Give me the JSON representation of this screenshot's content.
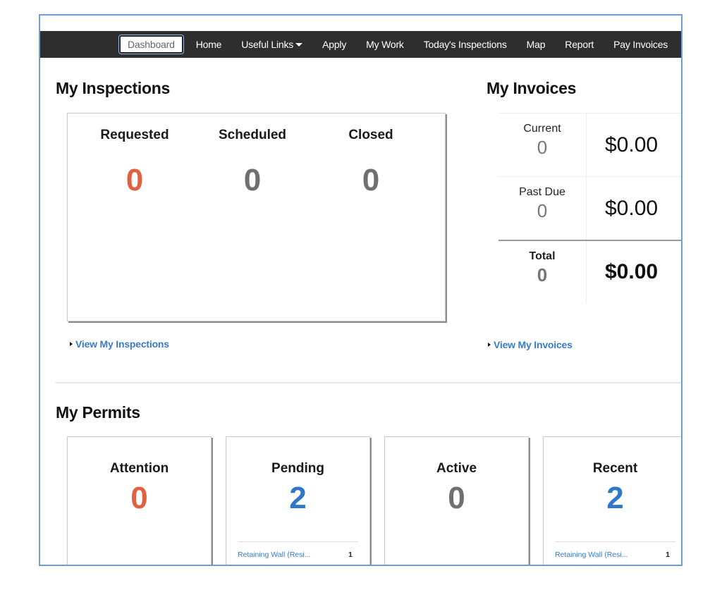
{
  "nav": {
    "items": [
      {
        "label": "Dashboard",
        "active": true
      },
      {
        "label": "Home"
      },
      {
        "label": "Useful Links",
        "has_dropdown": true
      },
      {
        "label": "Apply"
      },
      {
        "label": "My Work"
      },
      {
        "label": "Today's Inspections"
      },
      {
        "label": "Map"
      },
      {
        "label": "Report"
      },
      {
        "label": "Pay Invoices"
      }
    ]
  },
  "inspections": {
    "title": "My Inspections",
    "columns": [
      {
        "label": "Requested",
        "value": "0",
        "color": "#e0603f"
      },
      {
        "label": "Scheduled",
        "value": "0",
        "color": "#6f6f6f"
      },
      {
        "label": "Closed",
        "value": "0",
        "color": "#6f6f6f"
      }
    ],
    "link": "View My Inspections"
  },
  "invoices": {
    "title": "My Invoices",
    "rows": [
      {
        "label": "Current",
        "count": "0",
        "amount": "$0.00"
      },
      {
        "label": "Past Due",
        "count": "0",
        "amount": "$0.00"
      },
      {
        "label": "Total",
        "count": "0",
        "amount": "$0.00"
      }
    ],
    "link": "View My Invoices"
  },
  "permits": {
    "title": "My Permits",
    "cards": [
      {
        "label": "Attention",
        "value": "0",
        "color": "#e0603f"
      },
      {
        "label": "Pending",
        "value": "2",
        "color": "#2f78c6",
        "sub_item": {
          "name": "Retaining Wall (Resi...",
          "count": "1"
        }
      },
      {
        "label": "Active",
        "value": "0",
        "color": "#6f6f6f"
      },
      {
        "label": "Recent",
        "value": "2",
        "color": "#2f78c6",
        "sub_item": {
          "name": "Retaining Wall (Resi...",
          "count": "1"
        }
      }
    ]
  },
  "colors": {
    "frame": "#6e9fd6",
    "navbar": "#2e2e2e",
    "link": "#3a7bc8",
    "alert": "#e0603f",
    "highlight": "#2f78c6",
    "neutral": "#6f6f6f"
  }
}
